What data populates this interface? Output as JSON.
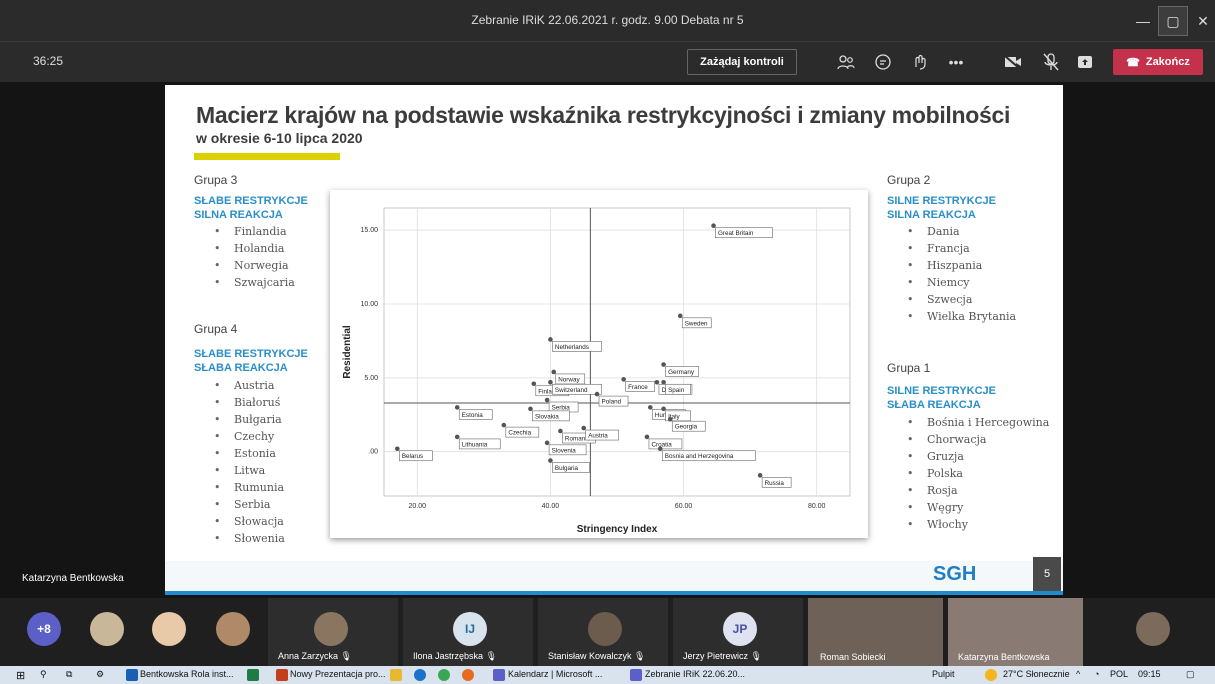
{
  "window": {
    "title": "Zebranie IRiK 22.06.2021 r. godz. 9.00 Debata nr 5"
  },
  "toolbar": {
    "timer": "36:25",
    "request_control": "Zażądaj kontroli",
    "end_call": "Zakończ"
  },
  "slide": {
    "title": "Macierz krajów na podstawie wskaźnika restrykcyjności i zmiany mobilności",
    "subtitle": "w okresie 6-10 lipca 2020",
    "group3": {
      "label": "Grupa 3",
      "h1": "SŁABE RESTRYKCJE",
      "h2": "SILNA REAKCJA",
      "items": [
        "Finlandia",
        "Holandia",
        "Norwegia",
        "Szwajcaria"
      ]
    },
    "group4": {
      "label": "Grupa 4",
      "h1": "SŁABE RESTRYKCJE",
      "h2": "SŁABA REAKCJA",
      "items": [
        "Austria",
        "Białoruś",
        "Bułgaria",
        "Czechy",
        "Estonia",
        "Litwa",
        "Rumunia",
        "Serbia",
        "Słowacja",
        "Słowenia"
      ]
    },
    "group2": {
      "label": "Grupa 2",
      "h1": "SILNE RESTRYKCJE",
      "h2": "SILNA REAKCJA",
      "items": [
        "Dania",
        "Francja",
        "Hiszpania",
        "Niemcy",
        "Szwecja",
        "Wielka Brytania"
      ]
    },
    "group1": {
      "label": "Grupa 1",
      "h1": "SILNE RESTRYKCJE",
      "h2": "SŁABA REAKCJA",
      "items": [
        "Bośnia i Hercegowina",
        "Chorwacja",
        "Gruzja",
        "Polska",
        "Rosja",
        "Węgry",
        "Włochy"
      ]
    },
    "logo": "SGH",
    "page_number": "5"
  },
  "chart_data": {
    "type": "scatter",
    "xlabel": "Stringency Index",
    "ylabel": "Residential",
    "xlim": [
      15,
      85
    ],
    "ylim": [
      -3,
      16.5
    ],
    "xticks": [
      "20.00",
      "40.00",
      "60.00",
      "80.00"
    ],
    "yticks": [
      ".00",
      "5.00",
      "10.00",
      "15.00"
    ],
    "ref_x": 46,
    "ref_y": 3.3,
    "points": [
      {
        "label": "Great Britain",
        "x": 64.5,
        "y": 15.3
      },
      {
        "label": "Sweden",
        "x": 59.5,
        "y": 9.2
      },
      {
        "label": "Netherlands",
        "x": 40,
        "y": 7.6
      },
      {
        "label": "Norway",
        "x": 40.5,
        "y": 5.4
      },
      {
        "label": "Germany",
        "x": 57,
        "y": 5.9
      },
      {
        "label": "France",
        "x": 51,
        "y": 4.9
      },
      {
        "label": "Denmark",
        "x": 56,
        "y": 4.7
      },
      {
        "label": "Spain",
        "x": 57,
        "y": 4.7
      },
      {
        "label": "Finland",
        "x": 37.5,
        "y": 4.6
      },
      {
        "label": "Switzerland",
        "x": 40,
        "y": 4.7
      },
      {
        "label": "Poland",
        "x": 47,
        "y": 3.9
      },
      {
        "label": "Serbia",
        "x": 39.5,
        "y": 3.5
      },
      {
        "label": "Estonia",
        "x": 26,
        "y": 3.0
      },
      {
        "label": "Slovakia",
        "x": 37,
        "y": 2.9
      },
      {
        "label": "Hungary",
        "x": 55,
        "y": 3.0
      },
      {
        "label": "Italy",
        "x": 57,
        "y": 2.9
      },
      {
        "label": "Georgia",
        "x": 58,
        "y": 2.2
      },
      {
        "label": "Czechia",
        "x": 33,
        "y": 1.8
      },
      {
        "label": "Romania",
        "x": 41.5,
        "y": 1.4
      },
      {
        "label": "Austria",
        "x": 45,
        "y": 1.6
      },
      {
        "label": "Croatia",
        "x": 54.5,
        "y": 1.0
      },
      {
        "label": "Lithuania",
        "x": 26,
        "y": 1.0
      },
      {
        "label": "Slovenia",
        "x": 39.5,
        "y": 0.6
      },
      {
        "label": "Belarus",
        "x": 17,
        "y": 0.2
      },
      {
        "label": "Bosnia and Herzegovina",
        "x": 56.5,
        "y": 0.2
      },
      {
        "label": "Bulgaria",
        "x": 40,
        "y": -0.6
      },
      {
        "label": "Russia",
        "x": 71.5,
        "y": -1.6
      }
    ]
  },
  "presenter": "Katarzyna Bentkowska",
  "roster": {
    "overflow": "+8",
    "participants": [
      {
        "name": "Anna Zarzycka"
      },
      {
        "name": "Ilona Jastrzębska",
        "initials": "IJ"
      },
      {
        "name": "Stanisław Kowalczyk"
      },
      {
        "name": "Jerzy Pietrewicz",
        "initials": "JP"
      },
      {
        "name": "Roman Sobiecki"
      },
      {
        "name": "Katarzyna Bentkowska"
      }
    ]
  },
  "taskbar": {
    "apps": [
      "Bentkowska Rola inst...",
      "Nowy Prezentacja pro...",
      "Kalendarz | Microsoft ...",
      "Zebranie IRiK 22.06.20..."
    ],
    "pulpit": "Pulpit",
    "weather": "27°C Słonecznie",
    "lang": "POL",
    "time": "09:15"
  },
  "colors": {
    "accent_blue": "#2a8fc8",
    "end_red": "#c4314b",
    "yellow": "#dcd000"
  }
}
